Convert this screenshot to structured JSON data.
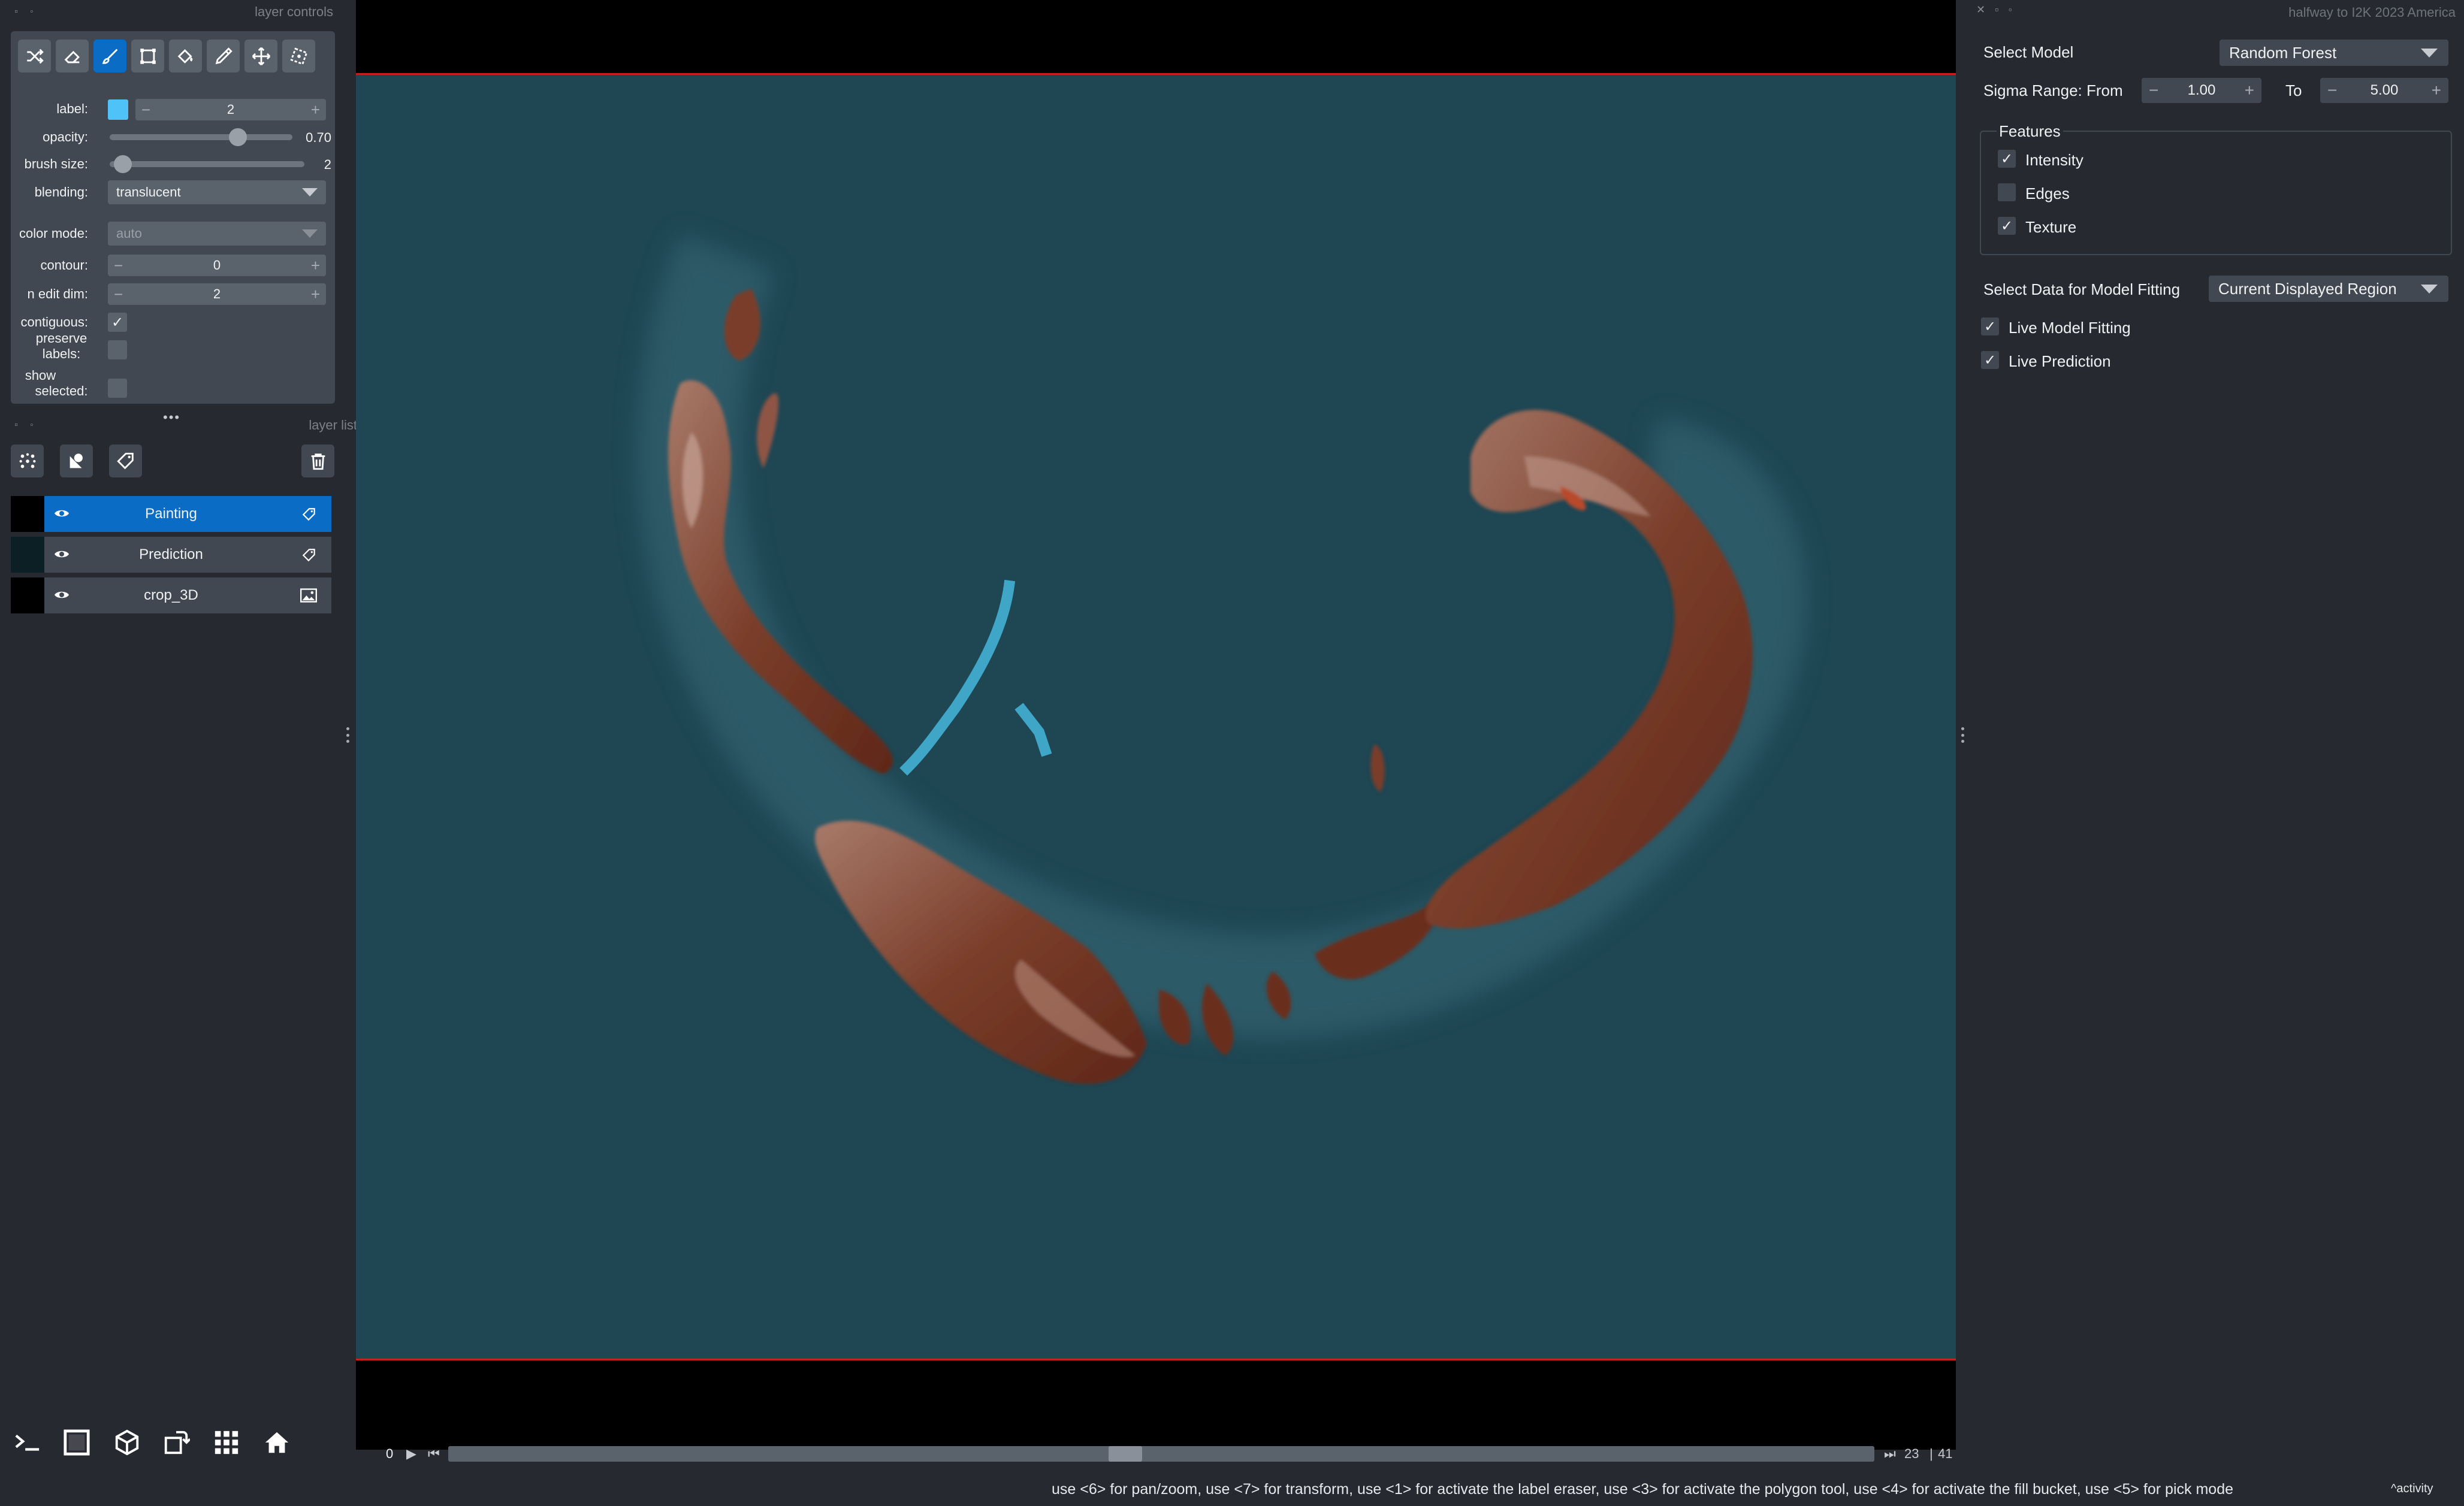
{
  "left_dock": {
    "controls_title": "layer controls",
    "list_title": "layer list",
    "tools": [
      "shuffle-icon",
      "eraser-icon",
      "paint-brush-icon",
      "polygon-icon",
      "fill-bucket-icon",
      "picker-icon",
      "pan-zoom-icon",
      "transform-icon"
    ],
    "active_tool": "paint-brush-icon",
    "label": {
      "name": "label:",
      "value": "2",
      "color": "#4fc3f7"
    },
    "opacity": {
      "name": "opacity:",
      "value": "0.70",
      "fraction": 0.7
    },
    "brush_size": {
      "name": "brush size:",
      "value": "2",
      "fraction": 0.02
    },
    "blending": {
      "name": "blending:",
      "value": "translucent"
    },
    "color_mode": {
      "name": "color mode:",
      "value": "auto"
    },
    "contour": {
      "name": "contour:",
      "value": "0"
    },
    "n_edit_dim": {
      "name": "n edit dim:",
      "value": "2"
    },
    "contiguous": {
      "name": "contiguous:",
      "checked": true
    },
    "preserve_labels": {
      "name_line1": "preserve",
      "name_line2": "labels:",
      "checked": false
    },
    "show_selected": {
      "name_line1": "show",
      "name_line2": "selected:",
      "checked": false
    },
    "layers": [
      {
        "name": "Painting",
        "type": "labels",
        "selected": true
      },
      {
        "name": "Prediction",
        "type": "labels",
        "selected": false
      },
      {
        "name": "crop_3D",
        "type": "image",
        "selected": false
      }
    ]
  },
  "right_dock": {
    "title": "halfway to I2K 2023 America",
    "select_model": {
      "label": "Select Model",
      "value": "Random Forest"
    },
    "sigma": {
      "label": "Sigma Range: From",
      "from": "1.00",
      "to_label": "To",
      "to": "5.00"
    },
    "features": {
      "title": "Features",
      "items": [
        {
          "label": "Intensity",
          "checked": true
        },
        {
          "label": "Edges",
          "checked": false
        },
        {
          "label": "Texture",
          "checked": true
        }
      ]
    },
    "data_select": {
      "label": "Select Data for Model Fitting",
      "value": "Current Displayed Region"
    },
    "live_fitting": {
      "label": "Live Model Fitting",
      "checked": true
    },
    "live_prediction": {
      "label": "Live Prediction",
      "checked": true
    }
  },
  "dims": {
    "start": "0",
    "current": "23",
    "total": "41",
    "fraction": 0.5
  },
  "status": {
    "text": "use <6> for pan/zoom, use <7> for transform, use <1> for activate the label eraser, use <3> for activate the polygon tool, use <4> for activate the fill bucket, use <5> for pick mode",
    "activity": "activity"
  },
  "colors": {
    "accent": "#0a6cc5",
    "background": "#262930",
    "panel": "#414851",
    "canvas_bg": "#1e4653",
    "label_color": "#4fc3f7",
    "prediction": "#8b3a26"
  }
}
